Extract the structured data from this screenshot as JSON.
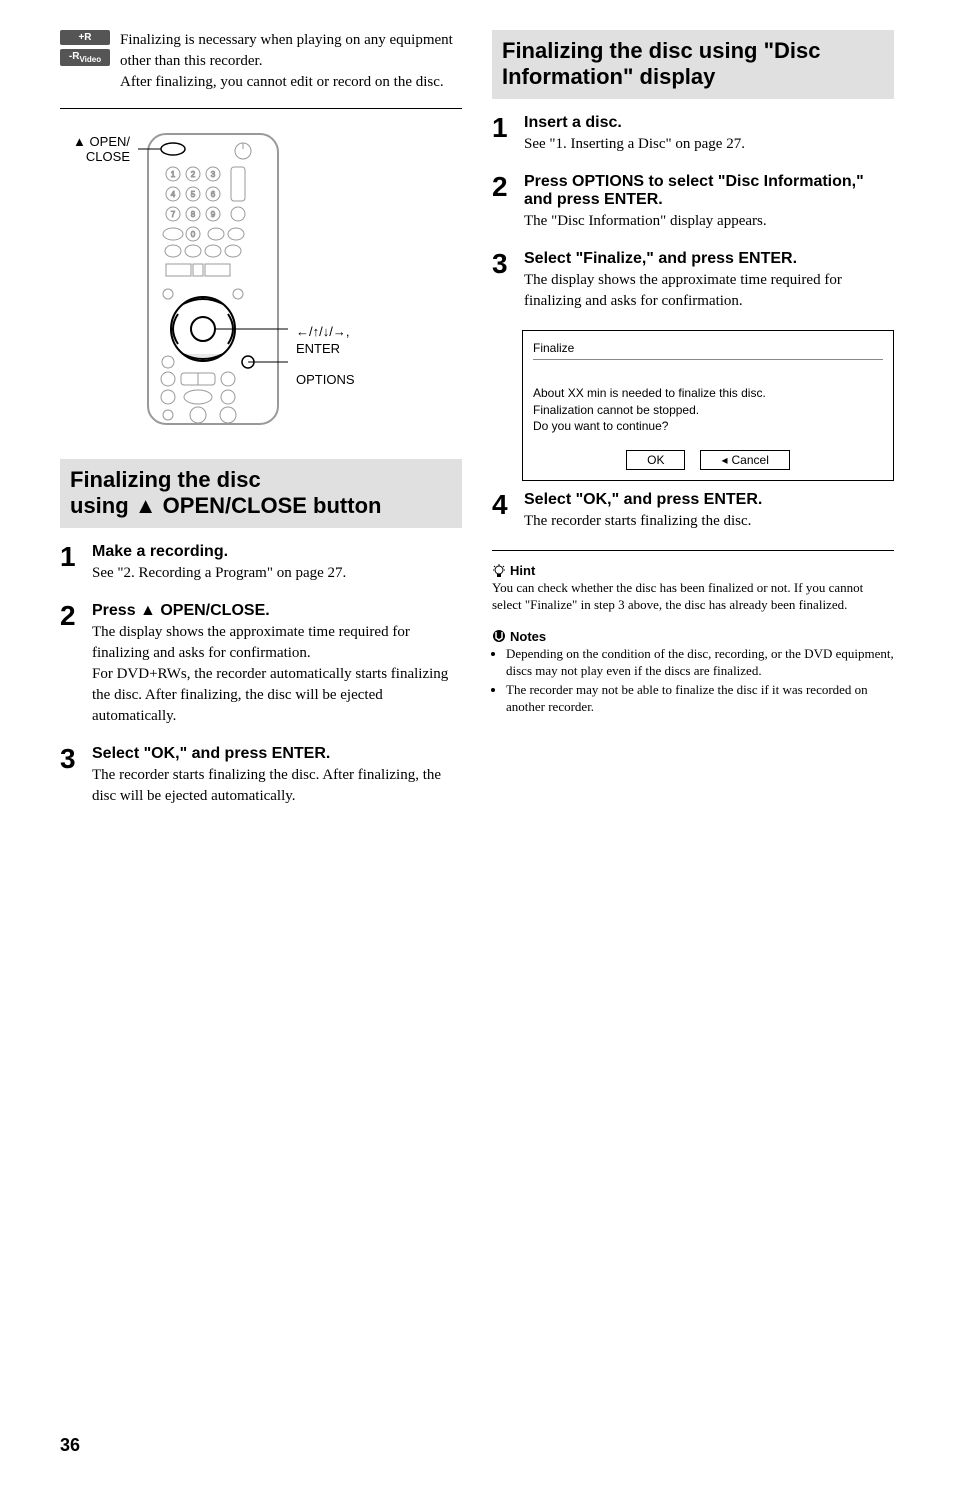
{
  "left": {
    "disc_tags": [
      "+R",
      "-RVideo"
    ],
    "finalizing_desc_1": "Finalizing is necessary when playing on any equipment other than this recorder.",
    "finalizing_desc_2": "After finalizing, you cannot edit or record on the disc.",
    "remote_label_left": "▲ OPEN/\nCLOSE",
    "remote_label_right_1": "←/↑/↓/→,",
    "remote_label_right_2": "ENTER",
    "remote_label_right_3": "OPTIONS",
    "section_header": "Finalizing the disc using ▲ OPEN/CLOSE button",
    "steps": [
      {
        "num": "1",
        "title": "Make a recording.",
        "desc": "See \"2. Recording a Program\" on page 27."
      },
      {
        "num": "2",
        "title": "Press ▲ OPEN/CLOSE.",
        "desc": "The display shows the approximate time required for finalizing and asks for confirmation.\nFor DVD+RWs, the recorder automatically starts finalizing the disc. After finalizing, the disc will be ejected automatically."
      },
      {
        "num": "3",
        "title": "Select \"OK,\" and press ENTER.",
        "desc": "The recorder starts finalizing the disc. After finalizing, the disc will be ejected automatically."
      }
    ]
  },
  "right": {
    "section_header": "Finalizing the disc using \"Disc Information\" display",
    "steps": [
      {
        "num": "1",
        "title": "Insert a disc.",
        "desc": "See \"1. Inserting a Disc\" on page 27."
      },
      {
        "num": "2",
        "title": "Press OPTIONS to select \"Disc Information,\" and press ENTER.",
        "desc": "The \"Disc Information\" display appears."
      },
      {
        "num": "3",
        "title": "Select \"Finalize,\" and press ENTER.",
        "desc": "The display shows the approximate time required for finalizing and asks for confirmation."
      },
      {
        "num": "4",
        "title": "Select \"OK,\" and press ENTER.",
        "desc": "The recorder starts finalizing the disc."
      }
    ],
    "dialog": {
      "title": "Finalize",
      "msg": "About XX min is needed to finalize this disc.\nFinalization cannot be stopped.\nDo you want to continue?",
      "btn_ok": "OK",
      "btn_cancel": "Cancel"
    },
    "hint_label": "Hint",
    "hint_text": "You can check whether the disc has been finalized or not. If you cannot select \"Finalize\" in step 3 above, the disc has already been finalized.",
    "notes_label": "Notes",
    "notes": [
      "Depending on the condition of the disc, recording, or the DVD equipment, discs may not play even if the discs are finalized.",
      "The recorder may not be able to finalize the disc if it was recorded on another recorder."
    ]
  },
  "page_number": "36"
}
